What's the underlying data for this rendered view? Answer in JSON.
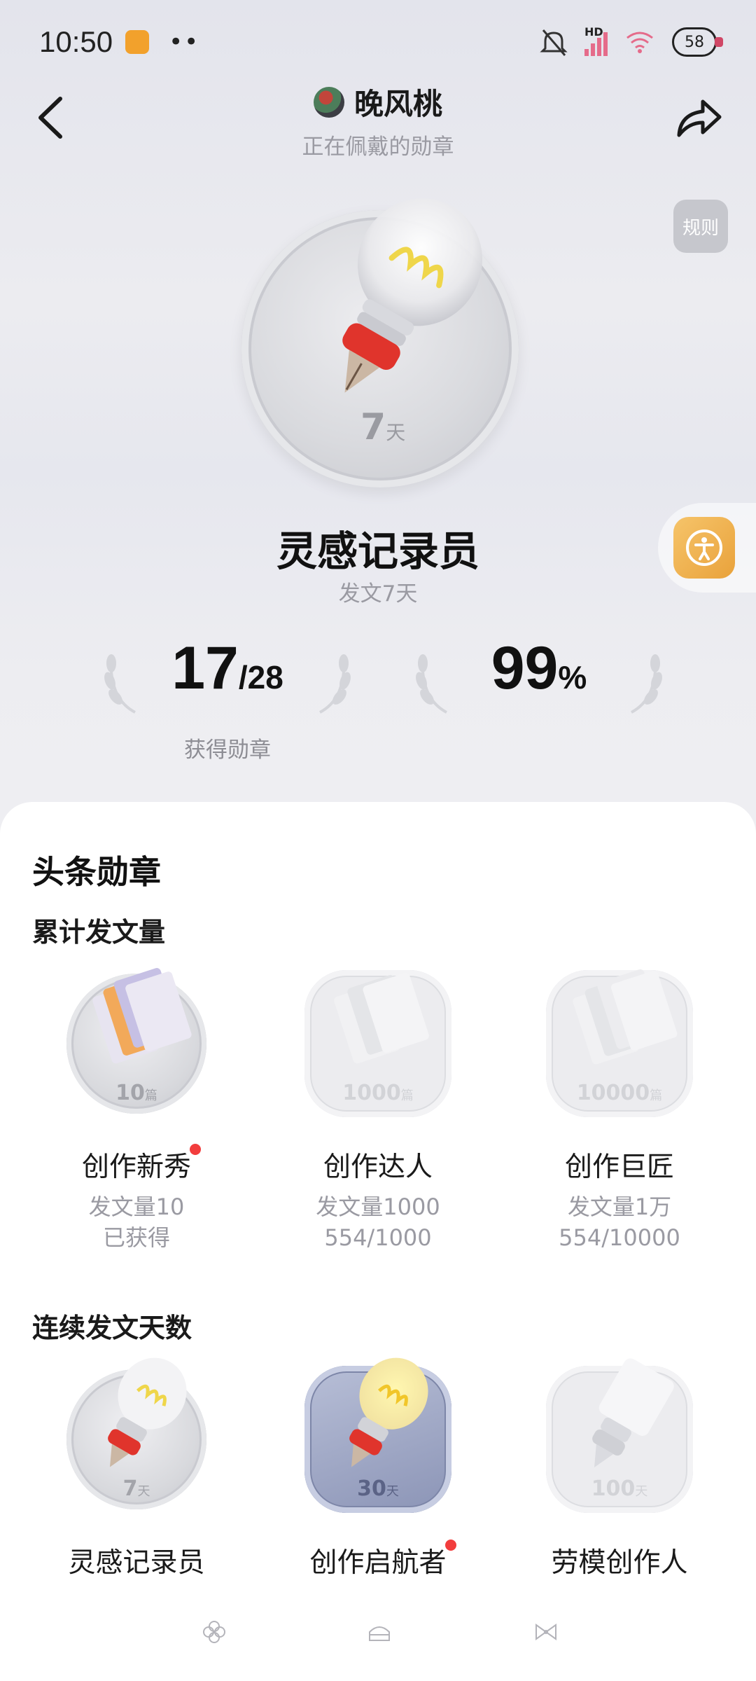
{
  "status": {
    "time": "10:50",
    "network_label": "HD",
    "battery": "58"
  },
  "header": {
    "username": "晚风桃",
    "subtitle": "正在佩戴的勋章",
    "rules_label": "规则"
  },
  "current_badge": {
    "days_number": "7",
    "days_unit": "天",
    "name": "灵感记录员",
    "description": "发文7天"
  },
  "stats": {
    "earned_value": "17",
    "earned_total": "/28",
    "earned_label": "获得勋章",
    "percent_value": "99",
    "percent_unit": "%"
  },
  "sheet": {
    "title": "头条勋章",
    "sections": [
      {
        "title": "累计发文量",
        "badges": [
          {
            "name": "创作新秀",
            "label_num": "10",
            "label_unit": "篇",
            "desc1": "发文量10",
            "desc2": "已获得",
            "new": true
          },
          {
            "name": "创作达人",
            "label_num": "1000",
            "label_unit": "篇",
            "desc1": "发文量1000",
            "desc2": "554/1000",
            "new": false
          },
          {
            "name": "创作巨匠",
            "label_num": "10000",
            "label_unit": "篇",
            "desc1": "发文量1万",
            "desc2": "554/10000",
            "new": false
          }
        ]
      },
      {
        "title": "连续发文天数",
        "badges": [
          {
            "name": "灵感记录员",
            "label_num": "7",
            "label_unit": "天",
            "new": false
          },
          {
            "name": "创作启航者",
            "label_num": "30",
            "label_unit": "天",
            "new": true
          },
          {
            "name": "劳模创作人",
            "label_num": "100",
            "label_unit": "天",
            "new": false
          }
        ]
      }
    ]
  },
  "colors": {
    "accent_red": "#f23d3d",
    "bulb_red": "#e0342c",
    "bulb_glow": "#f5e05a"
  }
}
